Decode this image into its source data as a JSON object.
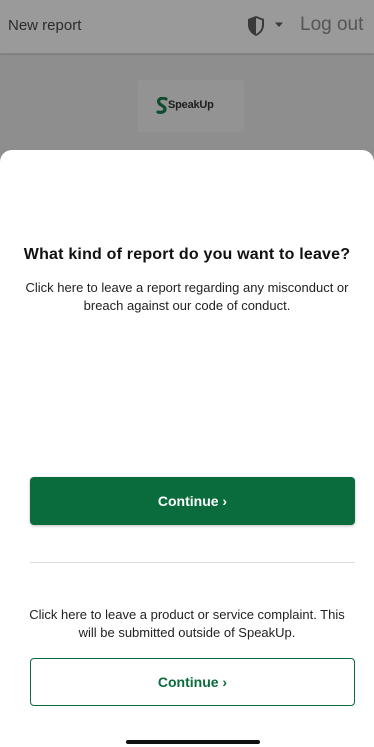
{
  "header": {
    "title": "New report",
    "logout_label": "Log out"
  },
  "logo": {
    "text": "SpeakUp"
  },
  "sheet": {
    "question": "What kind of report do you want to leave?",
    "misconduct_description": "Click here to leave a report regarding any misconduct or breach against our code of conduct.",
    "continue_primary_label": "Continue ›",
    "complaint_description": "Click here to leave a product or service complaint. This will be submitted outside of SpeakUp.",
    "continue_secondary_label": "Continue ›"
  },
  "colors": {
    "brand_green": "#0a6b3c",
    "overlay_grey": "#8f8f8f"
  },
  "icons": {
    "security": "shield-icon",
    "menu": "chevron-down-icon"
  }
}
